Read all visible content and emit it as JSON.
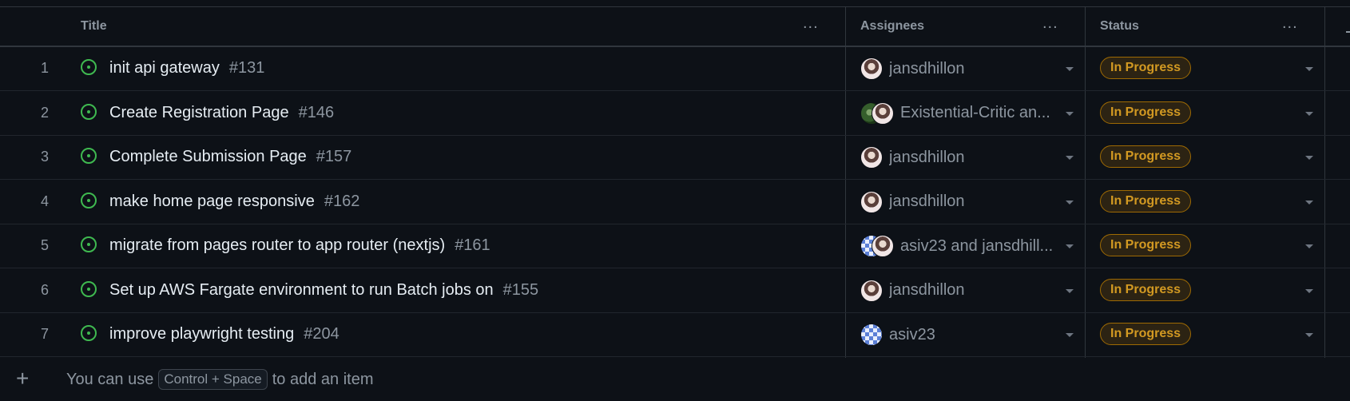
{
  "columns": {
    "title": "Title",
    "assignees": "Assignees",
    "status": "Status",
    "menu_icon": "..."
  },
  "rows": [
    {
      "num": "1",
      "title": "init api gateway",
      "issue": "#131",
      "assignee_text": "jansdhillon",
      "avatars": [
        "jans"
      ],
      "status": "In Progress"
    },
    {
      "num": "2",
      "title": "Create Registration Page",
      "issue": "#146",
      "assignee_text": "Existential-Critic an...",
      "avatars": [
        "ec",
        "jans"
      ],
      "status": "In Progress"
    },
    {
      "num": "3",
      "title": "Complete Submission Page",
      "issue": "#157",
      "assignee_text": "jansdhillon",
      "avatars": [
        "jans"
      ],
      "status": "In Progress"
    },
    {
      "num": "4",
      "title": "make home page responsive",
      "issue": "#162",
      "assignee_text": "jansdhillon",
      "avatars": [
        "jans"
      ],
      "status": "In Progress"
    },
    {
      "num": "5",
      "title": "migrate from pages router to app router (nextjs)",
      "issue": "#161",
      "assignee_text": "asiv23 and jansdhill...",
      "avatars": [
        "asiv",
        "jans"
      ],
      "status": "In Progress"
    },
    {
      "num": "6",
      "title": "Set up AWS Fargate environment to run Batch jobs on",
      "issue": "#155",
      "assignee_text": "jansdhillon",
      "avatars": [
        "jans"
      ],
      "status": "In Progress"
    },
    {
      "num": "7",
      "title": "improve playwright testing",
      "issue": "#204",
      "assignee_text": "asiv23",
      "avatars": [
        "asiv"
      ],
      "status": "In Progress"
    }
  ],
  "add_item": {
    "plus": "+",
    "hint_before": "You can use",
    "shortcut": "Control + Space",
    "hint_after": "to add an item"
  },
  "colors": {
    "background": "#0d1117",
    "open_issue_icon": "#3fb950",
    "status_in_progress": "#d29922"
  },
  "icons": {
    "issue": "issue-opened-icon",
    "menu": "kebab-horizontal-icon",
    "dropdown": "triangle-down-icon",
    "add": "plus-icon"
  }
}
